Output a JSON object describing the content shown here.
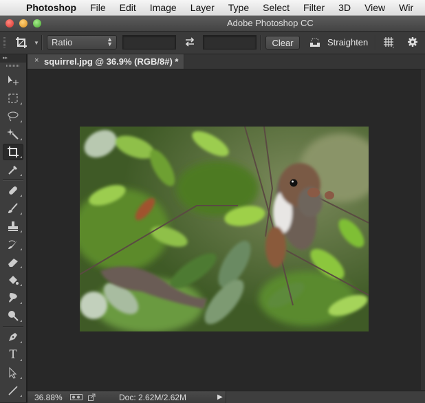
{
  "menubar": {
    "apple_icon": "apple-logo-icon",
    "app_name": "Photoshop",
    "items": [
      "File",
      "Edit",
      "Image",
      "Layer",
      "Type",
      "Select",
      "Filter",
      "3D",
      "View",
      "Wir"
    ]
  },
  "window": {
    "title": "Adobe Photoshop CC",
    "traffic_lights": {
      "close": "#e0443e",
      "minimize": "#e8a030",
      "zoom": "#5cb842"
    }
  },
  "options_bar": {
    "tool_icon": "crop-icon",
    "ratio_select": {
      "value": "Ratio"
    },
    "width_field": {
      "value": ""
    },
    "swap_icon": "swap-arrows-icon",
    "height_field": {
      "value": ""
    },
    "clear_label": "Clear",
    "straighten_icon": "level-icon",
    "straighten_label": "Straighten",
    "overlay_icon": "grid-icon",
    "settings_icon": "gear-icon"
  },
  "document_tab": {
    "close_glyph": "×",
    "title": "squirrel.jpg @ 36.9% (RGB/8#) *"
  },
  "toolbox": {
    "collapse_glyph": "▸▸",
    "tools": [
      {
        "name": "move",
        "active": false
      },
      {
        "name": "rectangular-marquee",
        "active": false
      },
      {
        "name": "lasso",
        "active": false
      },
      {
        "name": "magic-wand",
        "active": false
      },
      {
        "name": "crop",
        "active": true
      },
      {
        "name": "eyedropper",
        "active": false
      },
      {
        "name": "healing-brush",
        "active": false
      },
      {
        "name": "brush",
        "active": false
      },
      {
        "name": "clone-stamp",
        "active": false
      },
      {
        "name": "history-brush",
        "active": false
      },
      {
        "name": "eraser",
        "active": false
      },
      {
        "name": "paint-bucket",
        "active": false
      },
      {
        "name": "smudge",
        "active": false
      },
      {
        "name": "dodge",
        "active": false
      },
      {
        "name": "pen",
        "active": false
      },
      {
        "name": "type",
        "active": false
      },
      {
        "name": "path-selection",
        "active": false
      },
      {
        "name": "line",
        "active": false
      }
    ],
    "type_glyph": "T"
  },
  "canvas": {
    "image_description": "Gray squirrel among green leaves on branches"
  },
  "status_bar": {
    "zoom": "36.88%",
    "doc_info": "Doc: 2.62M/2.62M",
    "menu_arrow": "▶"
  }
}
